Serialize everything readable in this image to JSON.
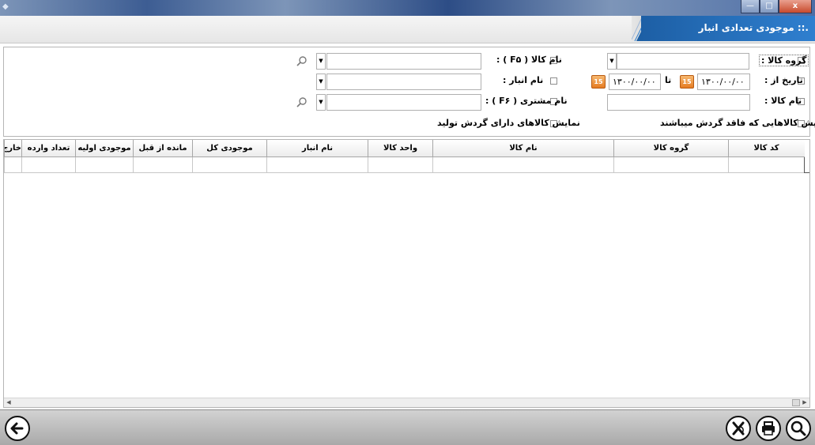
{
  "window": {
    "app_icon": "app-icon",
    "minimize": "—",
    "maximize": "□",
    "close": "x"
  },
  "header": {
    "title": ".:: موجودی تعدادی انبار"
  },
  "filters": {
    "group_label": "گروه کالا :",
    "date_from_label": "تاریخ از :",
    "date_from_value": "۱۳۰۰/۰۰/۰۰",
    "date_to_label": "تا",
    "date_to_value": "۱۳۰۰/۰۰/۰۰",
    "product_name_label": "نام کالا :",
    "product_name_f5_label": "نام کالا ( F۵ ) :",
    "warehouse_label": "نام انبار :",
    "customer_label": "نام مشتری ( F۶ ) :",
    "hide_no_turnover_label": "عدم نمایش کالاهایی که فاقد گردش میباشند",
    "show_production_label": "نمایش کالاهای دارای گردش تولید",
    "calendar_icon_text": "15"
  },
  "grid": {
    "columns": [
      "کد کالا",
      "گروه کالا",
      "نام کالا",
      "واحد کالا",
      "نام انبار",
      "موجودی کل",
      "مانده از قبل",
      "موجودی اولیه",
      "تعداد وارده",
      "خارج"
    ]
  },
  "toolbar": {
    "search_icon": "search-icon",
    "print_icon": "print-icon",
    "excel_icon": "excel-icon",
    "back_icon": "back-icon"
  },
  "colors": {
    "title_bar": "#2f7fcf",
    "calendar": "#e57c22",
    "toolbar_bg": "#bdbdbd"
  }
}
